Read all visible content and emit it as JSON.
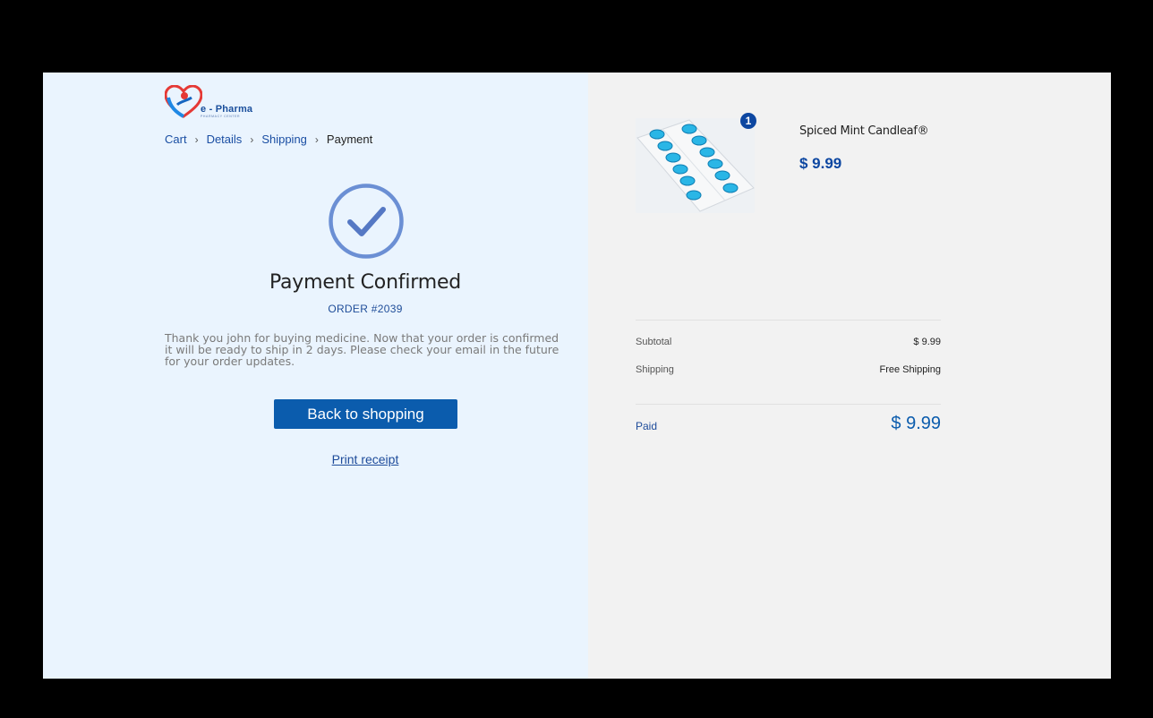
{
  "brand": {
    "name": "e - Pharma",
    "tagline": "PHARMACY CENTER"
  },
  "breadcrumb": {
    "items": [
      "Cart",
      "Details",
      "Shipping"
    ],
    "current": "Payment"
  },
  "confirmation": {
    "title": "Payment Confirmed",
    "order": "ORDER #2039",
    "message": " Thank you john for buying medicine. Now that your order is confirmed it will be ready to ship in 2 days. Please check your email in the future for your order updates.",
    "button": "Back to shopping",
    "print_link": "Print receipt"
  },
  "cart": {
    "item": {
      "name": "Spiced Mint Candleaf®",
      "price": "$ 9.99",
      "quantity": "1"
    }
  },
  "summary": {
    "subtotal_label": "Subtotal",
    "subtotal_value": "$ 9.99",
    "shipping_label": "Shipping",
    "shipping_value": "Free Shipping",
    "paid_label": "Paid",
    "paid_value": "$ 9.99"
  },
  "colors": {
    "accent": "#0b5cad",
    "left_panel": "#eaf4fe",
    "right_panel": "#f2f2f2"
  }
}
